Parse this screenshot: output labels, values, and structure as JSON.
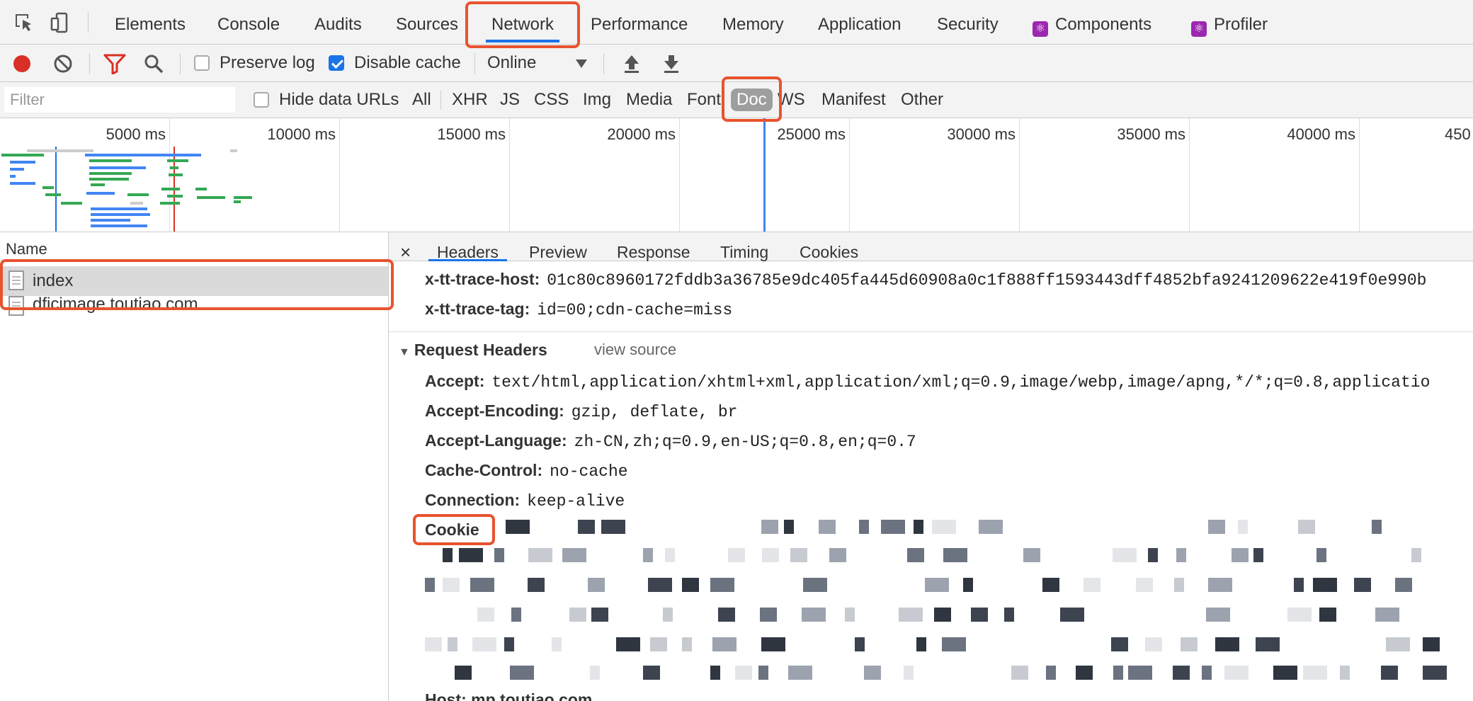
{
  "main_tabs": [
    "Elements",
    "Console",
    "Audits",
    "Sources",
    "Network",
    "Performance",
    "Memory",
    "Application",
    "Security",
    "Components",
    "Profiler"
  ],
  "active_tab": "Network",
  "toolbar": {
    "preserve_log": "Preserve log",
    "disable_cache": "Disable cache",
    "throttle": "Online",
    "preserve_log_checked": false,
    "disable_cache_checked": true
  },
  "filter": {
    "placeholder": "Filter",
    "hide_data_urls": "Hide data URLs",
    "types": [
      "All",
      "XHR",
      "JS",
      "CSS",
      "Img",
      "Media",
      "Font",
      "Doc",
      "WS",
      "Manifest",
      "Other"
    ],
    "selected_type": "Doc"
  },
  "overview": {
    "ticks": [
      "5000 ms",
      "10000 ms",
      "15000 ms",
      "20000 ms",
      "25000 ms",
      "30000 ms",
      "35000 ms",
      "40000 ms",
      "450"
    ]
  },
  "requests": {
    "header": "Name",
    "items": [
      "index",
      "dficimage.toutiao.com"
    ],
    "selected": "index"
  },
  "details": {
    "tabs": [
      "Headers",
      "Preview",
      "Response",
      "Timing",
      "Cookies"
    ],
    "active_tab": "Headers",
    "response_tail": [
      {
        "key": "x-tt-trace-host:",
        "value": "01c80c8960172fddb3a36785e9dc405fa445d60908a0c1f888ff1593443dff4852bfa9241209622e419f0e990b"
      },
      {
        "key": "x-tt-trace-tag:",
        "value": "id=00;cdn-cache=miss"
      }
    ],
    "request_headers_title": "Request Headers",
    "view_source": "view source",
    "request_headers": [
      {
        "key": "Accept:",
        "value": "text/html,application/xhtml+xml,application/xml;q=0.9,image/webp,image/apng,*/*;q=0.8,applicatio"
      },
      {
        "key": "Accept-Encoding:",
        "value": "gzip, deflate, br"
      },
      {
        "key": "Accept-Language:",
        "value": "zh-CN,zh;q=0.9,en-US;q=0.8,en;q=0.7"
      },
      {
        "key": "Cache-Control:",
        "value": "no-cache"
      },
      {
        "key": "Connection:",
        "value": "keep-alive"
      }
    ],
    "cookie_key": "Cookie",
    "host_partial": "Host: mp.toutiao.com"
  },
  "colors": {
    "accent": "#1a73e8",
    "highlight": "#e8532e",
    "record": "#d93025"
  }
}
